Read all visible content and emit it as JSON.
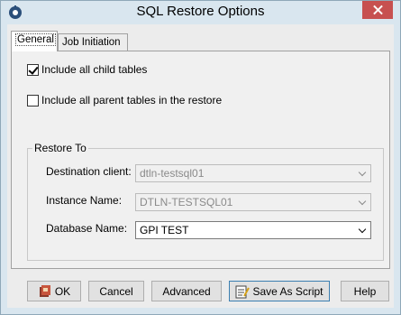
{
  "window": {
    "title": "SQL Restore Options"
  },
  "tabs": [
    {
      "label": "General"
    },
    {
      "label": "Job Initiation"
    }
  ],
  "options": {
    "include_child": {
      "label": "Include all child tables",
      "checked": true
    },
    "include_parent": {
      "label": "Include all parent tables in the restore",
      "checked": false
    }
  },
  "restore_to": {
    "legend": "Restore To",
    "destination_client": {
      "label": "Destination client:",
      "value": "dtln-testsql01"
    },
    "instance_name": {
      "label": "Instance Name:",
      "value": "DTLN-TESTSQL01"
    },
    "database_name": {
      "label": "Database Name:",
      "value": "GPI TEST"
    }
  },
  "buttons": {
    "ok": "OK",
    "cancel": "Cancel",
    "advanced": "Advanced",
    "save_as_script": "Save As Script",
    "help": "Help"
  },
  "colors": {
    "window_frame": "#d9e6ef",
    "close_button": "#c75050",
    "default_button_border": "#3c7fb1"
  },
  "icons": {
    "app": "app-settings-icon",
    "ok": "ok-icon",
    "save_script": "script-save-icon"
  }
}
